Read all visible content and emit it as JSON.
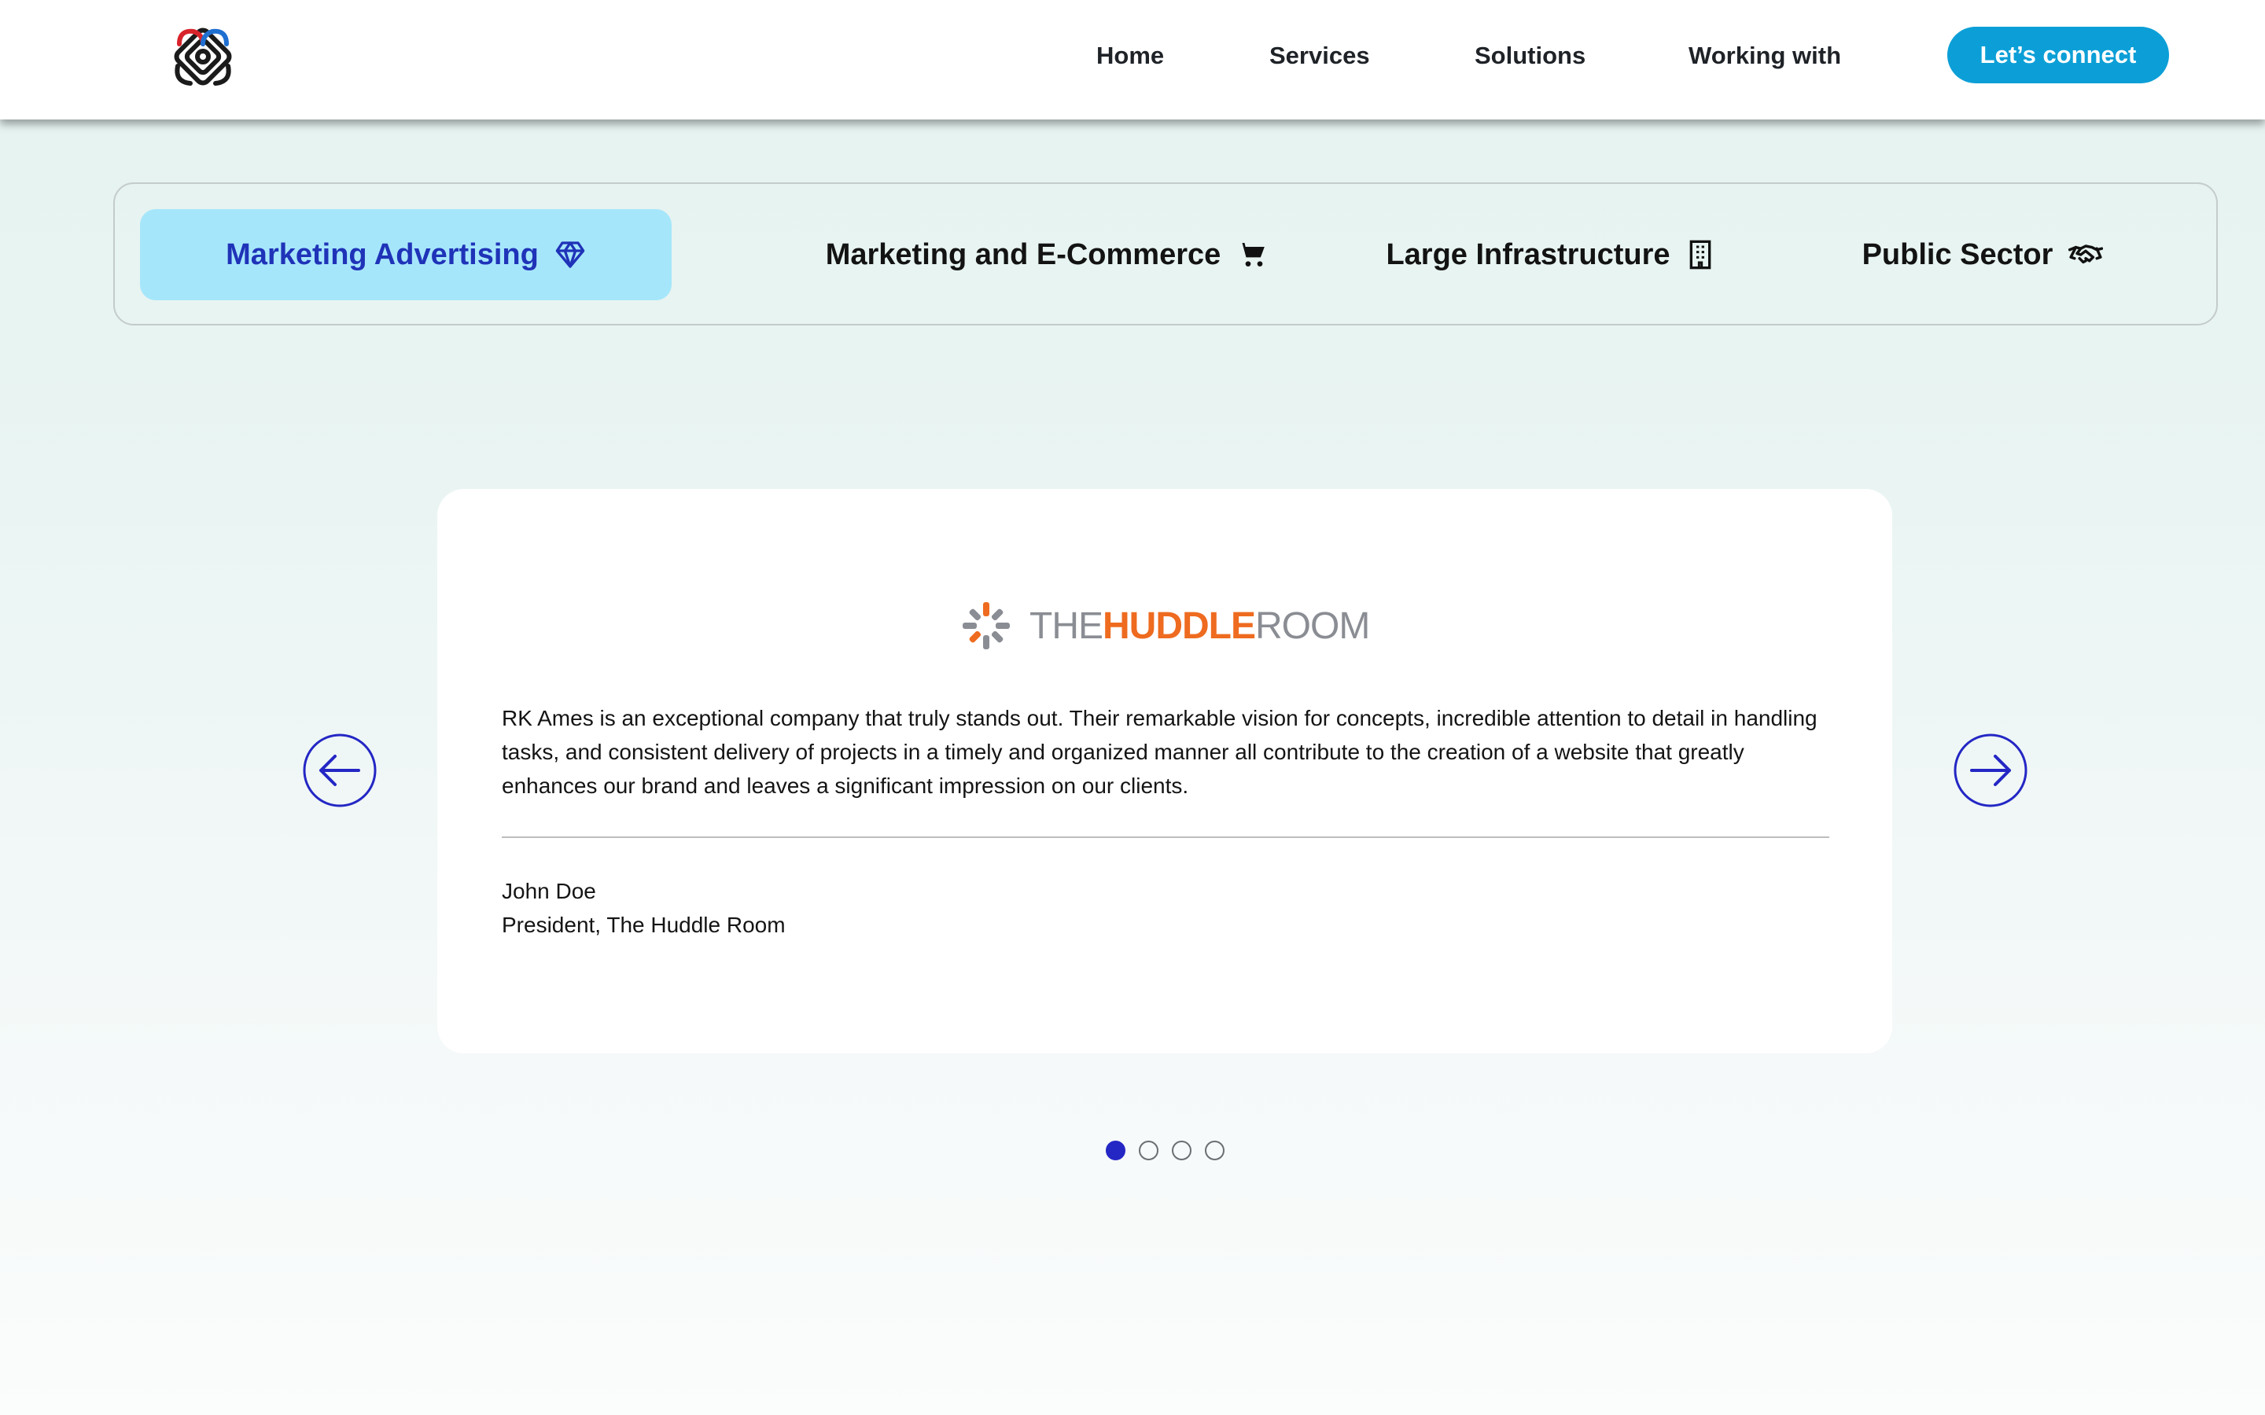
{
  "header": {
    "logo_icon": "celtic-knot-logo-icon",
    "nav": [
      {
        "label": "Home"
      },
      {
        "label": "Services"
      },
      {
        "label": "Solutions"
      },
      {
        "label": "Working with"
      }
    ],
    "cta_label": "Let’s connect",
    "cta_color": "#0c9fd7"
  },
  "tabs": [
    {
      "label": "Marketing Advertising",
      "icon": "diamond-icon",
      "active": true
    },
    {
      "label": "Marketing and E-Commerce",
      "icon": "shopping-cart-icon",
      "active": false
    },
    {
      "label": "Large Infrastructure",
      "icon": "building-icon",
      "active": false
    },
    {
      "label": "Public Sector",
      "icon": "handshake-icon",
      "active": false
    }
  ],
  "testimonial": {
    "brand_logo": {
      "word1": "THE",
      "word2": "HUDDLE",
      "word3": "ROOM",
      "accent": "#ee6b1f"
    },
    "quote": "RK Ames is an exceptional company that truly stands out. Their remarkable vision for concepts, incredible attention to detail in handling tasks, and consistent delivery of projects in a timely and organized manner all contribute to the creation of a website that greatly enhances our brand and leaves a significant impression on our clients.",
    "name": "John Doe",
    "role": "President, The Huddle Room"
  },
  "carousel": {
    "prev_icon": "arrow-left-circle-icon",
    "next_icon": "arrow-right-circle-icon",
    "slide_count": 4,
    "active_index": 0
  },
  "colors": {
    "active_tab_bg": "#a6e6fb",
    "active_tab_text": "#1f33b8",
    "arrow": "#2427c4"
  }
}
